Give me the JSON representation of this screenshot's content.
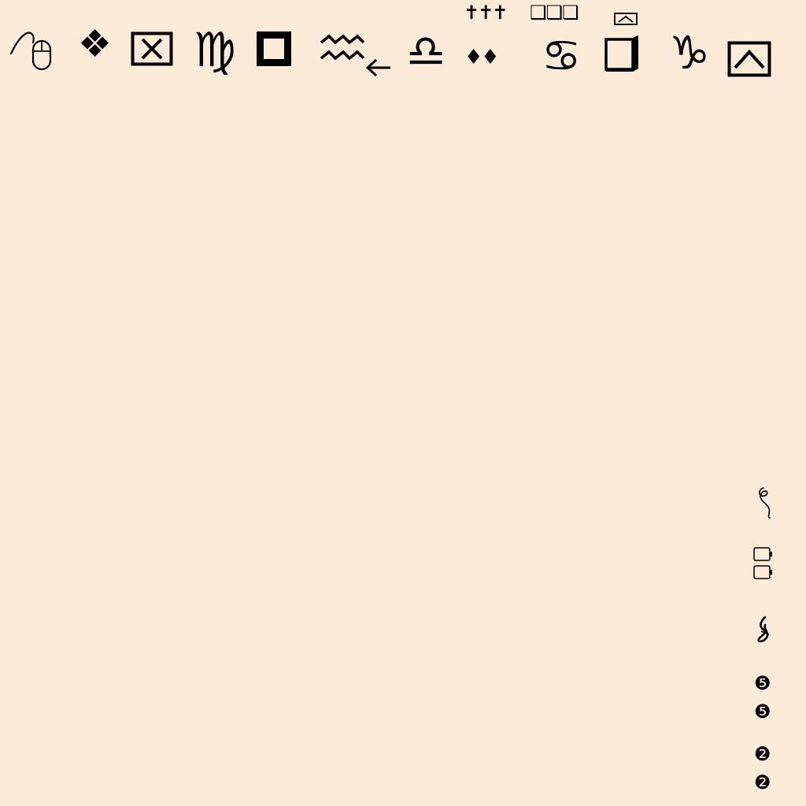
{
  "colors": {
    "background": "#fcebd8",
    "glyph": "#000000"
  },
  "top_row": {
    "cancer_symbol": "♋",
    "libra_symbol": "♎",
    "capricorn_symbol": "♑",
    "virgo_symbol": "♍",
    "diamond_ornament": "❖",
    "small_diamonds": "♦♦",
    "latin_crosses": "✝✝✝",
    "shadowed_squares": "❑❑❑"
  },
  "right_column": {
    "circled_five": "❺",
    "circled_two": "❷"
  },
  "icons": [
    "mouse-icon",
    "diamond-cluster-icon",
    "boxed-x-icon",
    "virgo-icon",
    "square-frame-icon",
    "zigzag-arrow-icon",
    "libra-icon",
    "cross-trio-icon",
    "small-diamonds-icon",
    "square-trio-icon",
    "cancer-icon",
    "mini-boxed-chevron-icon",
    "shadowed-box-icon",
    "capricorn-icon",
    "boxed-chevron-icon",
    "script-ornament-icon",
    "battery-icon",
    "clef-icon",
    "circled-number-icon"
  ]
}
